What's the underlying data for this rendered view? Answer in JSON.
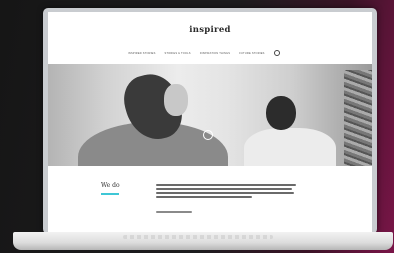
{
  "site": {
    "logo": "inspired"
  },
  "nav": {
    "items": [
      {
        "label": "Inspired stories"
      },
      {
        "label": "Stories & tools"
      },
      {
        "label": "Inspiration things"
      },
      {
        "label": "Future stories"
      }
    ],
    "search_icon": "search-icon"
  },
  "section": {
    "heading": "We do",
    "accent_color": "#3ec7d6"
  }
}
